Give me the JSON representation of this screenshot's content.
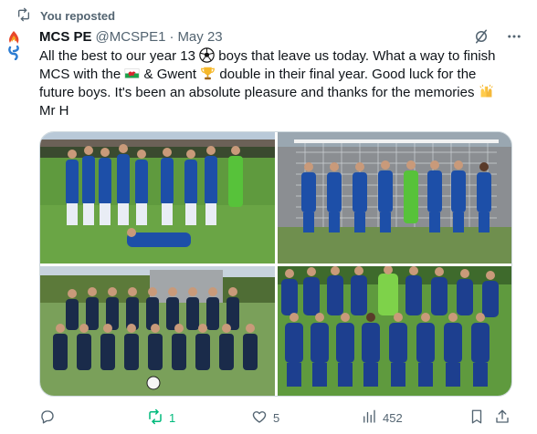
{
  "repost_banner": {
    "text": "You reposted",
    "icon": "repost-icon"
  },
  "author": {
    "name": "MCS PE",
    "handle": "@MCSPE1",
    "separator": "·",
    "date": "May 23"
  },
  "tweet": {
    "segments": [
      "All the best to our year 13 ",
      " boys that leave us today. What a way to finish MCS with the ",
      " & Gwent ",
      " double in their final year. Good luck for the future boys. It's been an absolute pleasure and thanks for the memories ",
      "\nMr H"
    ],
    "emojis": [
      "soccer-ball-emoji",
      "wales-flag-emoji",
      "trophy-emoji",
      "raised-hands-emoji"
    ]
  },
  "media": {
    "photos": [
      "team-photo-grass-medals",
      "team-photo-football-goal",
      "team-photo-school-yard",
      "team-photo-pitch-huddle"
    ]
  },
  "actions": {
    "reply": {
      "icon": "reply-icon",
      "count": ""
    },
    "repost": {
      "icon": "repost-icon",
      "count": "1",
      "color": "#00ba7c"
    },
    "like": {
      "icon": "heart-icon",
      "count": "5"
    },
    "views": {
      "icon": "views-icon",
      "count": "452"
    },
    "bookmark": {
      "icon": "bookmark-icon"
    },
    "share": {
      "icon": "share-icon"
    }
  },
  "colors": {
    "text": "#0f1419",
    "secondary": "#536471",
    "repost_active": "#00ba7c",
    "border": "#cfd9de"
  }
}
